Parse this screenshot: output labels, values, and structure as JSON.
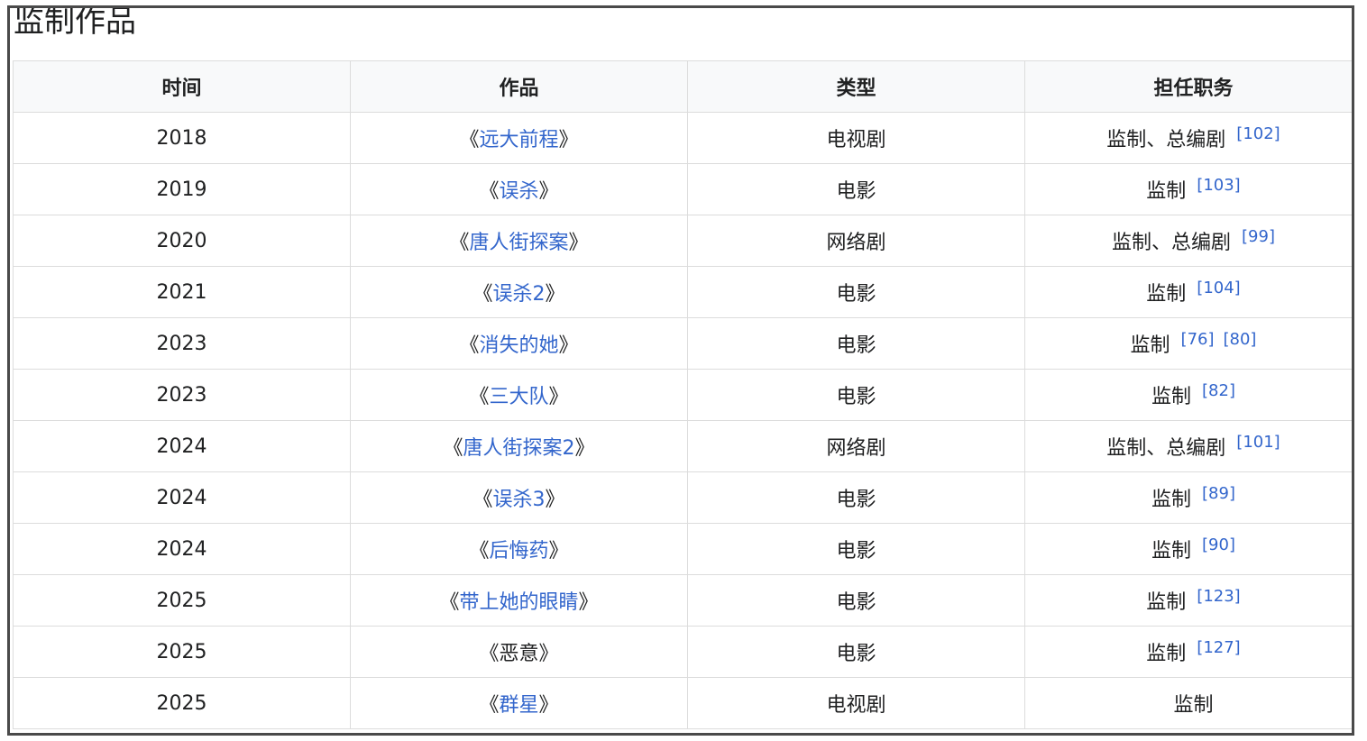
{
  "section": {
    "title": "监制作品"
  },
  "table": {
    "headers": [
      "时间",
      "作品",
      "类型",
      "担任职务"
    ],
    "rows": [
      {
        "year": "2018",
        "open": "《",
        "title": "远大前程",
        "close": "》",
        "linked": true,
        "type": "电视剧",
        "role": "监制、总编剧",
        "refs": [
          "[102]"
        ]
      },
      {
        "year": "2019",
        "open": "《",
        "title": "误杀",
        "close": "》",
        "linked": true,
        "type": "电影",
        "role": "监制",
        "refs": [
          "[103]"
        ]
      },
      {
        "year": "2020",
        "open": "《",
        "title": "唐人街探案",
        "close": "》",
        "linked": true,
        "type": "网络剧",
        "role": "监制、总编剧",
        "refs": [
          "[99]"
        ]
      },
      {
        "year": "2021",
        "open": "《",
        "title": "误杀2",
        "close": "》",
        "linked": true,
        "type": "电影",
        "role": "监制",
        "refs": [
          "[104]"
        ]
      },
      {
        "year": "2023",
        "open": "《",
        "title": "消失的她",
        "close": "》",
        "linked": true,
        "type": "电影",
        "role": "监制",
        "refs": [
          "[76]",
          "[80]"
        ]
      },
      {
        "year": "2023",
        "open": "《",
        "title": "三大队",
        "close": "》",
        "linked": true,
        "type": "电影",
        "role": "监制",
        "refs": [
          "[82]"
        ]
      },
      {
        "year": "2024",
        "open": "《",
        "title": "唐人街探案2",
        "close": "》",
        "linked": true,
        "type": "网络剧",
        "role": "监制、总编剧",
        "refs": [
          "[101]"
        ]
      },
      {
        "year": "2024",
        "open": "《",
        "title": "误杀3",
        "close": "》",
        "linked": true,
        "type": "电影",
        "role": "监制",
        "refs": [
          "[89]"
        ]
      },
      {
        "year": "2024",
        "open": "《",
        "title": "后悔药",
        "close": "》",
        "linked": true,
        "type": "电影",
        "role": "监制",
        "refs": [
          "[90]"
        ]
      },
      {
        "year": "2025",
        "open": "《",
        "title": "带上她的眼睛",
        "close": "》",
        "linked": true,
        "type": "电影",
        "role": "监制",
        "refs": [
          "[123]"
        ]
      },
      {
        "year": "2025",
        "open": "《",
        "title": "恶意",
        "close": "》",
        "linked": false,
        "type": "电影",
        "role": "监制",
        "refs": [
          "[127]"
        ]
      },
      {
        "year": "2025",
        "open": "《",
        "title": "群星",
        "close": "》",
        "linked": true,
        "type": "电视剧",
        "role": "监制",
        "refs": []
      }
    ]
  },
  "colors": {
    "link": "#3366cc",
    "text": "#202122",
    "header_bg": "#f8f9fa",
    "border": "#dcdcdc",
    "frame": "#4a4a4a"
  }
}
